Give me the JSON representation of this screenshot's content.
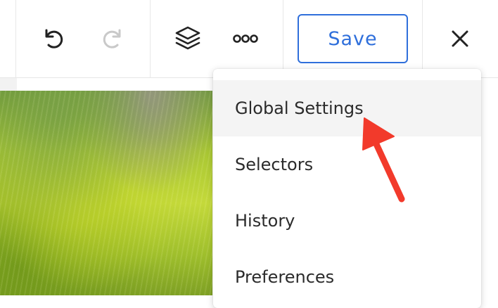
{
  "toolbar": {
    "undo_icon": "undo-icon",
    "redo_icon": "redo-icon",
    "layers_icon": "layers-icon",
    "more_icon": "more-icon",
    "save_label": "Save",
    "close_icon": "close-icon",
    "accent_color": "#2f6fdb"
  },
  "menu": {
    "items": [
      {
        "label": "Global Settings",
        "highlighted": true
      },
      {
        "label": "Selectors",
        "highlighted": false
      },
      {
        "label": "History",
        "highlighted": false
      },
      {
        "label": "Preferences",
        "highlighted": false
      }
    ]
  },
  "annotation": {
    "arrow_color": "#f23a2b"
  }
}
